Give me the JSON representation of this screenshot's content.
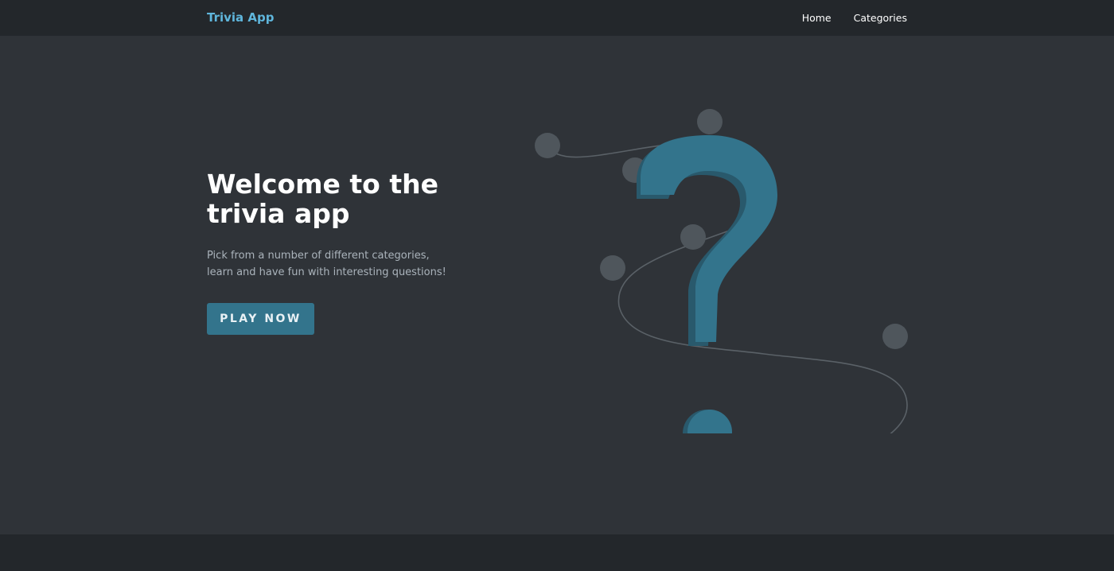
{
  "navbar": {
    "brand": "Trivia App",
    "links": [
      {
        "label": "Home"
      },
      {
        "label": "Categories"
      }
    ]
  },
  "hero": {
    "title": "Welcome to the trivia app",
    "subtitle": "Pick from a number of different categories, learn and have fun with interesting questions!",
    "cta_label": "PLAY NOW"
  },
  "illustration": {
    "icon": "question-mark-people-illustration"
  },
  "colors": {
    "brand": "#5fb6dc",
    "accent": "#33748c",
    "background": "#2f3338",
    "navbar": "#23272b"
  }
}
